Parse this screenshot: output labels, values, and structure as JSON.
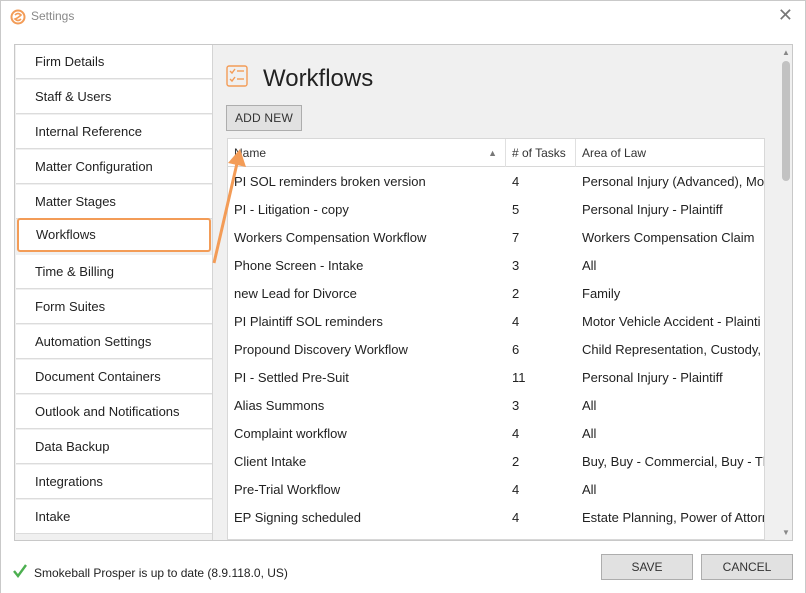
{
  "window": {
    "title": "Settings",
    "close_glyph": "✕"
  },
  "colors": {
    "accent": "#f39c57",
    "check": "#4caf50",
    "button": "#e1e1e1"
  },
  "sidebar": {
    "items": [
      {
        "label": "Firm Details"
      },
      {
        "label": "Staff & Users"
      },
      {
        "label": "Internal Reference"
      },
      {
        "label": "Matter Configuration"
      },
      {
        "label": "Matter Stages"
      },
      {
        "label": "Workflows",
        "active": true
      },
      {
        "label": "Time & Billing"
      },
      {
        "label": "Form Suites"
      },
      {
        "label": "Automation Settings"
      },
      {
        "label": "Document Containers"
      },
      {
        "label": "Outlook and Notifications"
      },
      {
        "label": "Data Backup"
      },
      {
        "label": "Integrations"
      },
      {
        "label": "Intake"
      }
    ]
  },
  "main": {
    "title": "Workflows",
    "icon": "checklist-icon",
    "add_button": "ADD NEW",
    "table": {
      "columns": [
        "Name",
        "# of Tasks",
        "Area of Law"
      ],
      "sort_column": "Name",
      "rows": [
        [
          "PI  SOL reminders broken version",
          "4",
          "Personal Injury (Advanced), Mot"
        ],
        [
          "PI - Litigation - copy",
          "5",
          "Personal Injury - Plaintiff"
        ],
        [
          "Workers Compensation Workflow",
          "7",
          "Workers Compensation Claim"
        ],
        [
          "Phone Screen - Intake",
          "3",
          "All"
        ],
        [
          "new Lead for Divorce",
          "2",
          "Family"
        ],
        [
          "PI Plaintiff SOL reminders",
          "4",
          "Motor Vehicle Accident - Plainti"
        ],
        [
          "Propound Discovery Workflow",
          "6",
          "Child Representation, Custody, "
        ],
        [
          "PI - Settled Pre-Suit",
          "11",
          "Personal Injury - Plaintiff"
        ],
        [
          "Alias Summons",
          "3",
          "All"
        ],
        [
          "Complaint workflow",
          "4",
          "All"
        ],
        [
          "Client Intake",
          "2",
          "Buy, Buy - Commercial, Buy - Th"
        ],
        [
          "Pre-Trial Workflow",
          "4",
          "All"
        ],
        [
          "EP Signing scheduled",
          "4",
          "Estate Planning, Power of Attorn"
        ]
      ]
    }
  },
  "footer": {
    "status": "Smokeball Prosper is up to date (8.9.118.0, US)",
    "save": "SAVE",
    "cancel": "CANCEL"
  }
}
